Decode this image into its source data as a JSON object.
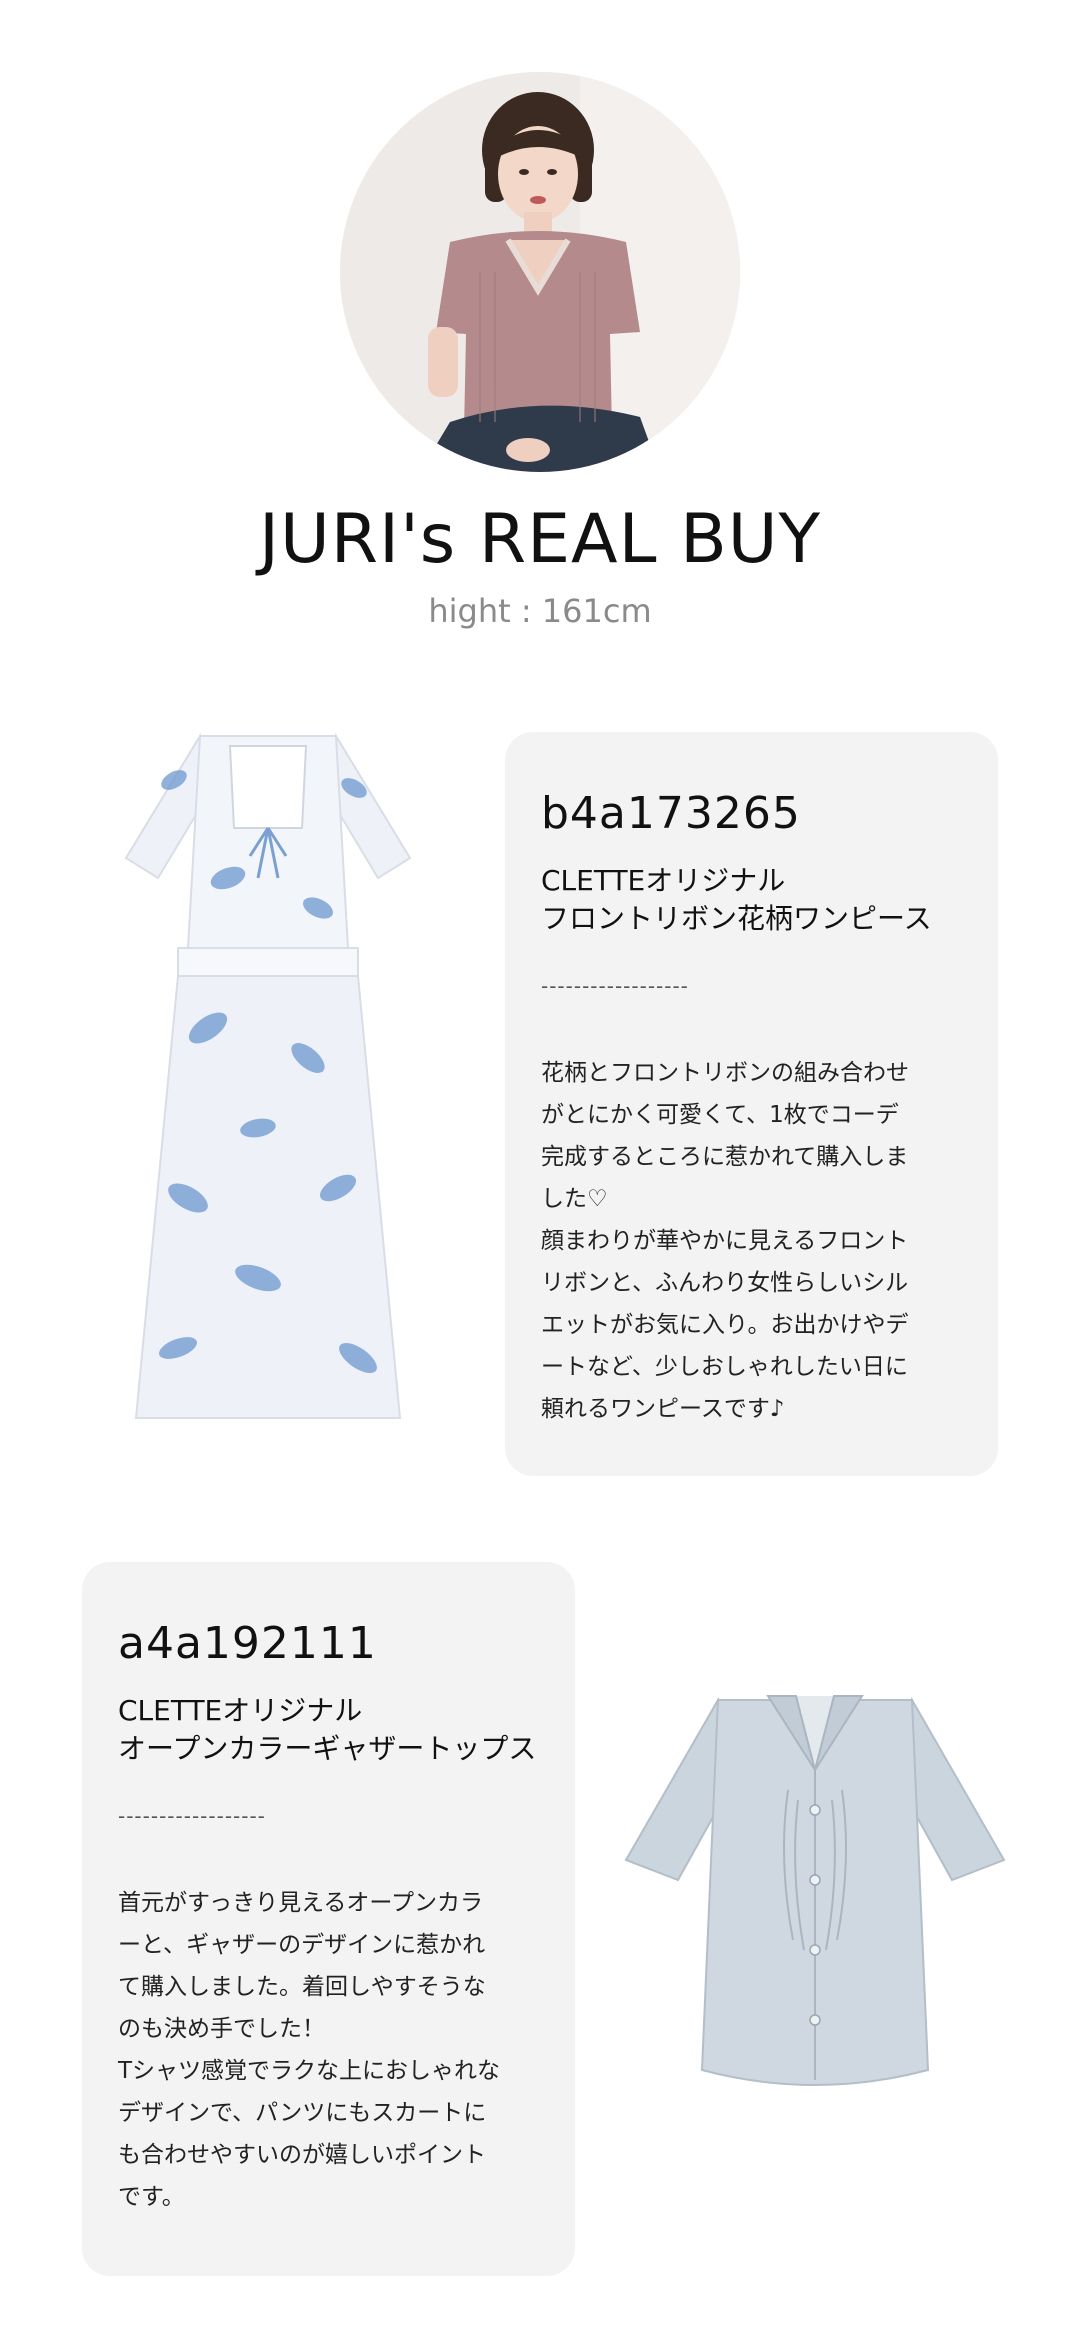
{
  "header": {
    "title": "JURI's REAL BUY",
    "subtitle": "hight : 161cm"
  },
  "items": [
    {
      "code": "b4a173265",
      "name_line1": "CLETTEオリジナル",
      "name_line2": "フロントリボン花柄ワンピース",
      "divider": "------------------",
      "desc_lines": [
        "花柄とフロントリボンの組み合わせ",
        "がとにかく可愛くて、1枚でコーデ",
        "完成するところに惹かれて購入しま",
        "した♡",
        "顔まわりが華やかに見えるフロント",
        "リボンと、ふんわり女性らしいシル",
        "エットがお気に入り。お出かけやデ",
        "ートなど、少しおしゃれしたい日に",
        "頼れるワンピースです♪"
      ]
    },
    {
      "code": "a4a192111",
      "name_line1": "CLETTEオリジナル",
      "name_line2": "オープンカラーギャザートップス",
      "divider": "------------------",
      "desc_lines": [
        "首元がすっきり見えるオープンカラ",
        "ーと、ギャザーのデザインに惹かれ",
        "て購入しました。着回しやすそうな",
        "のも決め手でした！",
        "Tシャツ感覚でラクな上におしゃれな",
        "デザインで、パンツにもスカートに",
        "も合わせやすいのが嬉しいポイント",
        "です。"
      ]
    }
  ],
  "colors": {
    "card_bg": "#f3f3f3",
    "subtitle": "#8a8a8a",
    "dress_print": "#6d98cf",
    "shirt": "#c9d3dc"
  }
}
